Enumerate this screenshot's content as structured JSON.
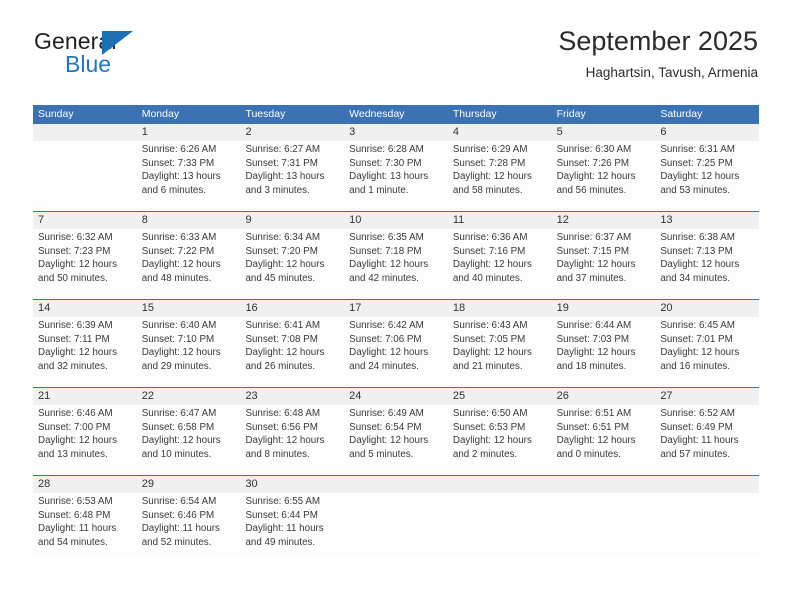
{
  "brand": {
    "name_part1": "General",
    "name_part2": "Blue",
    "accent_color": "#1c6fb4"
  },
  "header": {
    "title": "September 2025",
    "subtitle": "Haghartsin, Tavush, Armenia"
  },
  "theme": {
    "header_row_bg": "#3a72b3",
    "daynum_band_bg": "#f0f0f0",
    "divider_color": "#3a72b3",
    "text_color": "#3a3a3a"
  },
  "calendar": {
    "weekday_headers": [
      "Sunday",
      "Monday",
      "Tuesday",
      "Wednesday",
      "Thursday",
      "Friday",
      "Saturday"
    ],
    "weeks": [
      {
        "days": [
          {
            "num": "",
            "lines": []
          },
          {
            "num": "1",
            "lines": [
              "Sunrise: 6:26 AM",
              "Sunset: 7:33 PM",
              "Daylight: 13 hours",
              "and 6 minutes."
            ]
          },
          {
            "num": "2",
            "lines": [
              "Sunrise: 6:27 AM",
              "Sunset: 7:31 PM",
              "Daylight: 13 hours",
              "and 3 minutes."
            ]
          },
          {
            "num": "3",
            "lines": [
              "Sunrise: 6:28 AM",
              "Sunset: 7:30 PM",
              "Daylight: 13 hours",
              "and 1 minute."
            ]
          },
          {
            "num": "4",
            "lines": [
              "Sunrise: 6:29 AM",
              "Sunset: 7:28 PM",
              "Daylight: 12 hours",
              "and 58 minutes."
            ]
          },
          {
            "num": "5",
            "lines": [
              "Sunrise: 6:30 AM",
              "Sunset: 7:26 PM",
              "Daylight: 12 hours",
              "and 56 minutes."
            ]
          },
          {
            "num": "6",
            "lines": [
              "Sunrise: 6:31 AM",
              "Sunset: 7:25 PM",
              "Daylight: 12 hours",
              "and 53 minutes."
            ]
          }
        ]
      },
      {
        "days": [
          {
            "num": "7",
            "lines": [
              "Sunrise: 6:32 AM",
              "Sunset: 7:23 PM",
              "Daylight: 12 hours",
              "and 50 minutes."
            ]
          },
          {
            "num": "8",
            "lines": [
              "Sunrise: 6:33 AM",
              "Sunset: 7:22 PM",
              "Daylight: 12 hours",
              "and 48 minutes."
            ]
          },
          {
            "num": "9",
            "lines": [
              "Sunrise: 6:34 AM",
              "Sunset: 7:20 PM",
              "Daylight: 12 hours",
              "and 45 minutes."
            ]
          },
          {
            "num": "10",
            "lines": [
              "Sunrise: 6:35 AM",
              "Sunset: 7:18 PM",
              "Daylight: 12 hours",
              "and 42 minutes."
            ]
          },
          {
            "num": "11",
            "lines": [
              "Sunrise: 6:36 AM",
              "Sunset: 7:16 PM",
              "Daylight: 12 hours",
              "and 40 minutes."
            ]
          },
          {
            "num": "12",
            "lines": [
              "Sunrise: 6:37 AM",
              "Sunset: 7:15 PM",
              "Daylight: 12 hours",
              "and 37 minutes."
            ]
          },
          {
            "num": "13",
            "lines": [
              "Sunrise: 6:38 AM",
              "Sunset: 7:13 PM",
              "Daylight: 12 hours",
              "and 34 minutes."
            ]
          }
        ]
      },
      {
        "days": [
          {
            "num": "14",
            "lines": [
              "Sunrise: 6:39 AM",
              "Sunset: 7:11 PM",
              "Daylight: 12 hours",
              "and 32 minutes."
            ]
          },
          {
            "num": "15",
            "lines": [
              "Sunrise: 6:40 AM",
              "Sunset: 7:10 PM",
              "Daylight: 12 hours",
              "and 29 minutes."
            ]
          },
          {
            "num": "16",
            "lines": [
              "Sunrise: 6:41 AM",
              "Sunset: 7:08 PM",
              "Daylight: 12 hours",
              "and 26 minutes."
            ]
          },
          {
            "num": "17",
            "lines": [
              "Sunrise: 6:42 AM",
              "Sunset: 7:06 PM",
              "Daylight: 12 hours",
              "and 24 minutes."
            ]
          },
          {
            "num": "18",
            "lines": [
              "Sunrise: 6:43 AM",
              "Sunset: 7:05 PM",
              "Daylight: 12 hours",
              "and 21 minutes."
            ]
          },
          {
            "num": "19",
            "lines": [
              "Sunrise: 6:44 AM",
              "Sunset: 7:03 PM",
              "Daylight: 12 hours",
              "and 18 minutes."
            ]
          },
          {
            "num": "20",
            "lines": [
              "Sunrise: 6:45 AM",
              "Sunset: 7:01 PM",
              "Daylight: 12 hours",
              "and 16 minutes."
            ]
          }
        ]
      },
      {
        "days": [
          {
            "num": "21",
            "lines": [
              "Sunrise: 6:46 AM",
              "Sunset: 7:00 PM",
              "Daylight: 12 hours",
              "and 13 minutes."
            ]
          },
          {
            "num": "22",
            "lines": [
              "Sunrise: 6:47 AM",
              "Sunset: 6:58 PM",
              "Daylight: 12 hours",
              "and 10 minutes."
            ]
          },
          {
            "num": "23",
            "lines": [
              "Sunrise: 6:48 AM",
              "Sunset: 6:56 PM",
              "Daylight: 12 hours",
              "and 8 minutes."
            ]
          },
          {
            "num": "24",
            "lines": [
              "Sunrise: 6:49 AM",
              "Sunset: 6:54 PM",
              "Daylight: 12 hours",
              "and 5 minutes."
            ]
          },
          {
            "num": "25",
            "lines": [
              "Sunrise: 6:50 AM",
              "Sunset: 6:53 PM",
              "Daylight: 12 hours",
              "and 2 minutes."
            ]
          },
          {
            "num": "26",
            "lines": [
              "Sunrise: 6:51 AM",
              "Sunset: 6:51 PM",
              "Daylight: 12 hours",
              "and 0 minutes."
            ]
          },
          {
            "num": "27",
            "lines": [
              "Sunrise: 6:52 AM",
              "Sunset: 6:49 PM",
              "Daylight: 11 hours",
              "and 57 minutes."
            ]
          }
        ]
      },
      {
        "days": [
          {
            "num": "28",
            "lines": [
              "Sunrise: 6:53 AM",
              "Sunset: 6:48 PM",
              "Daylight: 11 hours",
              "and 54 minutes."
            ]
          },
          {
            "num": "29",
            "lines": [
              "Sunrise: 6:54 AM",
              "Sunset: 6:46 PM",
              "Daylight: 11 hours",
              "and 52 minutes."
            ]
          },
          {
            "num": "30",
            "lines": [
              "Sunrise: 6:55 AM",
              "Sunset: 6:44 PM",
              "Daylight: 11 hours",
              "and 49 minutes."
            ]
          },
          {
            "num": "",
            "lines": []
          },
          {
            "num": "",
            "lines": []
          },
          {
            "num": "",
            "lines": []
          },
          {
            "num": "",
            "lines": []
          }
        ]
      }
    ]
  }
}
